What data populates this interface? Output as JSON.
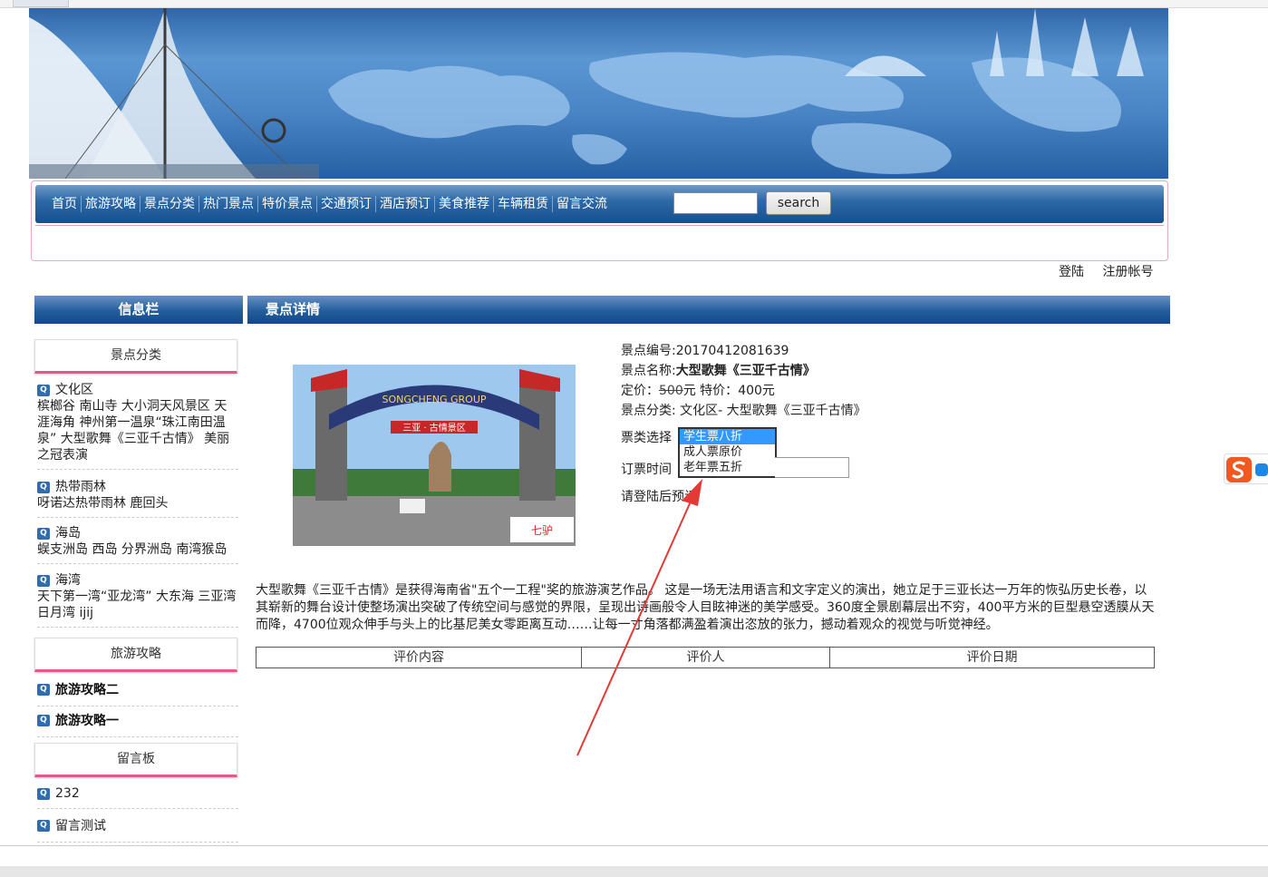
{
  "nav": {
    "items": [
      "首页",
      "旅游攻略",
      "景点分类",
      "热门景点",
      "特价景点",
      "交通预订",
      "酒店预订",
      "美食推荐",
      "车辆租赁",
      "留言交流"
    ],
    "search_label": "search"
  },
  "user": {
    "login": "登陆",
    "register": "注册帐号"
  },
  "sidebar": {
    "title": "信息栏",
    "category_title": "景点分类",
    "categories": [
      {
        "name": "文化区",
        "items": "槟榔谷 南山寺 大小洞天风景区 天涯海角 神州第一温泉“珠江南田温泉” 大型歌舞《三亚千古情》 美丽之冠表演"
      },
      {
        "name": "热带雨林",
        "items": "呀诺达热带雨林 鹿回头"
      },
      {
        "name": "海岛",
        "items": "蜈支洲岛 西岛 分界洲岛 南湾猴岛"
      },
      {
        "name": "海湾",
        "items": "天下第一湾“亚龙湾” 大东海 三亚湾 日月湾 ijij"
      }
    ],
    "strategy_title": "旅游攻略",
    "strategies": [
      "旅游攻略二",
      "旅游攻略一"
    ],
    "board_title": "留言板",
    "messages": [
      "232",
      "留言测试"
    ]
  },
  "content": {
    "title": "景点详情",
    "id_label": "景点编号:",
    "id_value": "20170412081639",
    "name_label": "景点名称:",
    "name_value": "大型歌舞《三亚千古情》",
    "price_label": "定价：",
    "price_value": "500",
    "price_unit": "元 特价：",
    "special_price": "400元",
    "category_label": "景点分类: 文化区- 大型歌舞《三亚千古情》",
    "ticket_label": "票类选择",
    "ticket_options": [
      "学生票八折",
      "成人票原价",
      "老年票五折"
    ],
    "date_label": "订票时间",
    "login_note": "请登陆后预订",
    "photo_text": "SONGCHENG GROUP",
    "photo_sign": "三亚 · 古情景区",
    "photo_logo": "七驴",
    "description": "大型歌舞《三亚千古情》是获得海南省\"五个一工程\"奖的旅游演艺作品。 这是一场无法用语言和文字定义的演出，她立足于三亚长达一万年的恢弘历史长卷，以其崭新的舞台设计使整场演出突破了传统空间与感觉的界限，呈现出诗画般令人目眩神迷的美学感受。360度全景剧幕层出不穷，400平方米的巨型悬空透膜从天而降，4700位观众伸手与头上的比基尼美女零距离互动……让每一寸角落都满盈着演出恣放的张力，撼动着观众的视觉与听觉神经。",
    "table_headers": [
      "评价内容",
      "评价人",
      "评价日期"
    ]
  },
  "colors": {
    "accent_pink": "#e15a8e",
    "nav_blue": "#154f8e",
    "select_blue": "#3399ff",
    "arrow_red": "#e53935"
  }
}
